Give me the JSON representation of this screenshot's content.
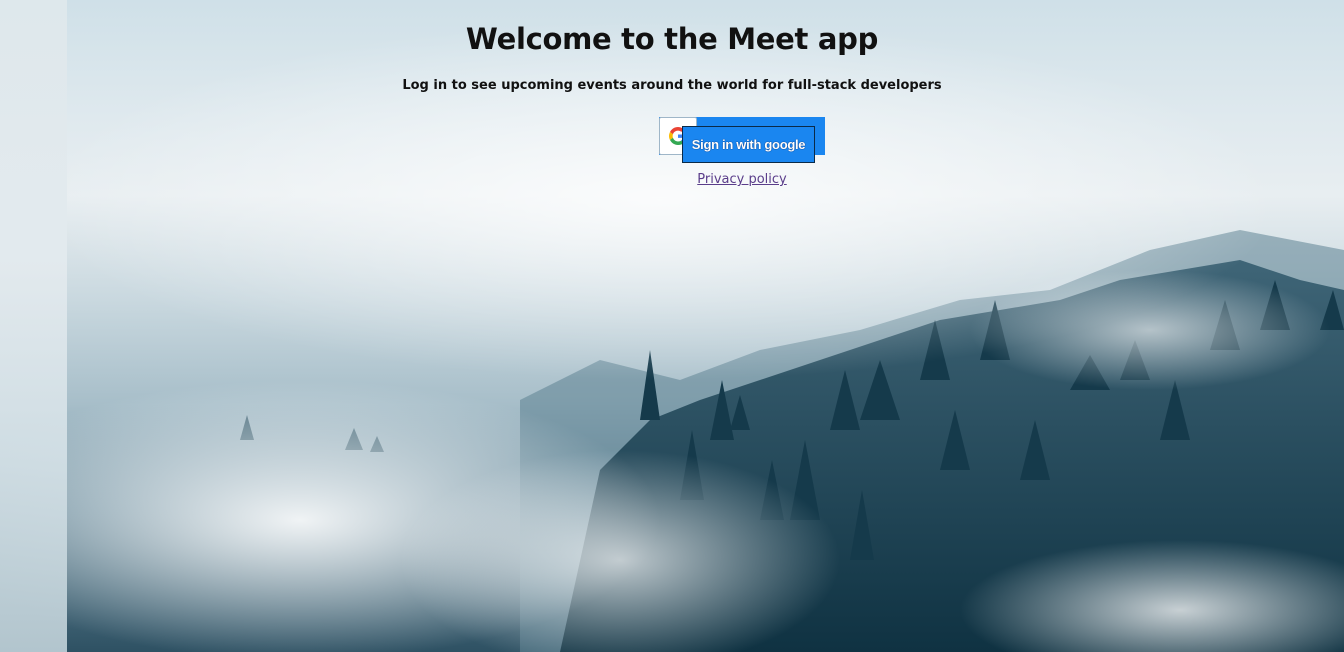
{
  "page": {
    "title": "Welcome to the Meet app",
    "subtitle": "Log in to see upcoming events around the world for full-stack developers"
  },
  "login": {
    "google_button_label": "Sign in with google",
    "google_icon": "google-g-icon",
    "privacy_link": "Privacy policy"
  },
  "colors": {
    "button_blue": "#1a86f0",
    "link_visited": "#5a3d8a"
  },
  "background": {
    "image": "misty-forest-photo"
  }
}
